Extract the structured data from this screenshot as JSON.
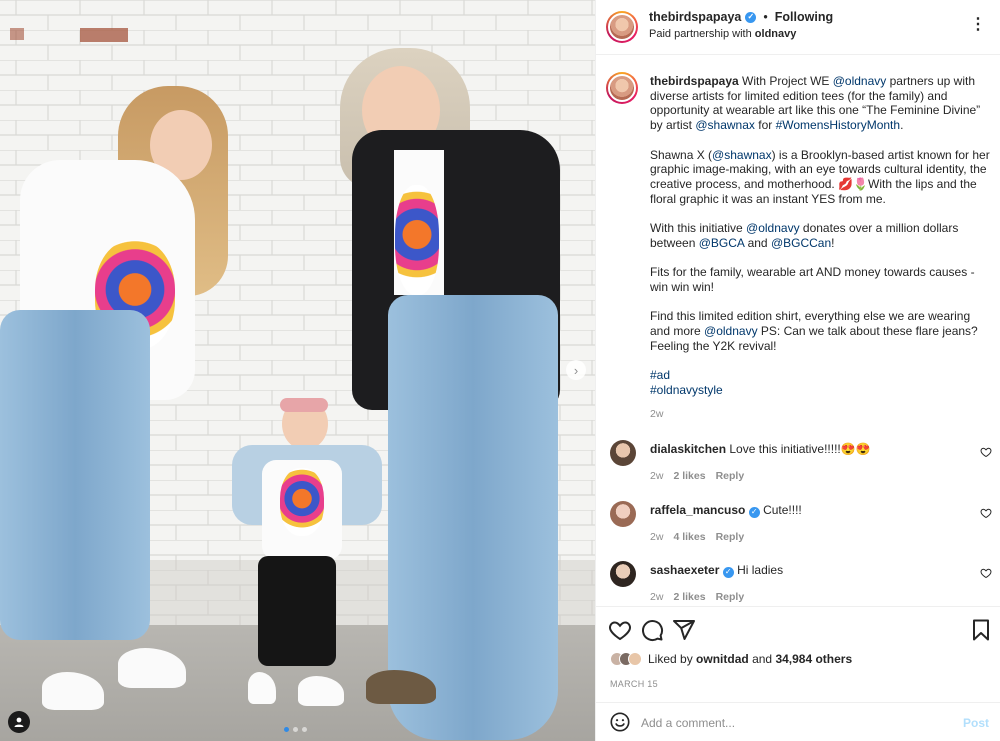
{
  "header": {
    "username": "thebirdspapaya",
    "separator": "•",
    "follow_label": "Following",
    "subtitle_prefix": "Paid partnership with",
    "partner": "oldnavy",
    "more_icon": "more-horizontal-icon"
  },
  "caption": {
    "username": "thebirdspapaya",
    "p1": [
      {
        "t": "With Project WE ",
        "k": "text"
      },
      {
        "t": "@oldnavy",
        "k": "link"
      },
      {
        "t": " partners up with diverse artists for limited edition tees (for the family) and opportunity at wearable art like this one “The Feminine Divine” by artist ",
        "k": "text"
      },
      {
        "t": "@shawnax",
        "k": "link"
      },
      {
        "t": " for ",
        "k": "text"
      },
      {
        "t": "#WomensHistoryMonth",
        "k": "link"
      },
      {
        "t": ".",
        "k": "text"
      }
    ],
    "p2": [
      {
        "t": "Shawna X (",
        "k": "text"
      },
      {
        "t": "@shawnax",
        "k": "link"
      },
      {
        "t": ") is a Brooklyn-based artist known for her graphic image-making, with an eye towards cultural identity, the creative process, and motherhood. 💋🌷With the lips and the floral graphic it was an instant YES from me.",
        "k": "text"
      }
    ],
    "p3": [
      {
        "t": "With this initiative ",
        "k": "text"
      },
      {
        "t": "@oldnavy",
        "k": "link"
      },
      {
        "t": " donates over a million dollars between ",
        "k": "text"
      },
      {
        "t": "@BGCA",
        "k": "link"
      },
      {
        "t": " and ",
        "k": "text"
      },
      {
        "t": "@BGCCan",
        "k": "link"
      },
      {
        "t": "!",
        "k": "text"
      }
    ],
    "p4": [
      {
        "t": "Fits for the family, wearable art AND money towards causes - win win win!",
        "k": "text"
      }
    ],
    "p5": [
      {
        "t": "Find this limited edition shirt, everything else we are wearing and more ",
        "k": "text"
      },
      {
        "t": "@oldnavy",
        "k": "link"
      },
      {
        "t": " PS: Can we talk about these flare jeans? Feeling the Y2K revival!",
        "k": "text"
      }
    ],
    "hashtag1": "#ad",
    "hashtag2": "#oldnavystyle",
    "time": "2w"
  },
  "comments": [
    {
      "username": "dialaskitchen",
      "verified": false,
      "text": "Love this initiative!!!!!😍😍",
      "time": "2w",
      "likes": "2 likes",
      "reply": "Reply"
    },
    {
      "username": "raffela_mancuso",
      "verified": true,
      "text": "Cute!!!!",
      "time": "2w",
      "likes": "4 likes",
      "reply": "Reply"
    },
    {
      "username": "sashaexeter",
      "verified": true,
      "text": "Hi ladies",
      "time": "2w",
      "likes": "2 likes",
      "reply": "Reply"
    }
  ],
  "actions": {
    "like_icon": "heart-icon",
    "comment_icon": "comment-icon",
    "share_icon": "share-icon",
    "save_icon": "bookmark-icon",
    "liked_by_prefix": "Liked by",
    "liked_by_user": "ownitdad",
    "liked_by_joiner": "and",
    "likes_count": "34,984 others",
    "date": "MARCH 15"
  },
  "add_comment": {
    "placeholder": "Add a comment...",
    "post_label": "Post"
  },
  "carousel": {
    "next_icon": "chevron-right-icon",
    "tag_icon": "user-tag-icon",
    "slides": 3,
    "active_slide": 1
  },
  "colors": {
    "verified": "#3897f0",
    "link": "#00376b",
    "muted": "#8e8e8e",
    "post_disabled": "#b2dffc",
    "carousel_active": "#2f8ae6"
  }
}
